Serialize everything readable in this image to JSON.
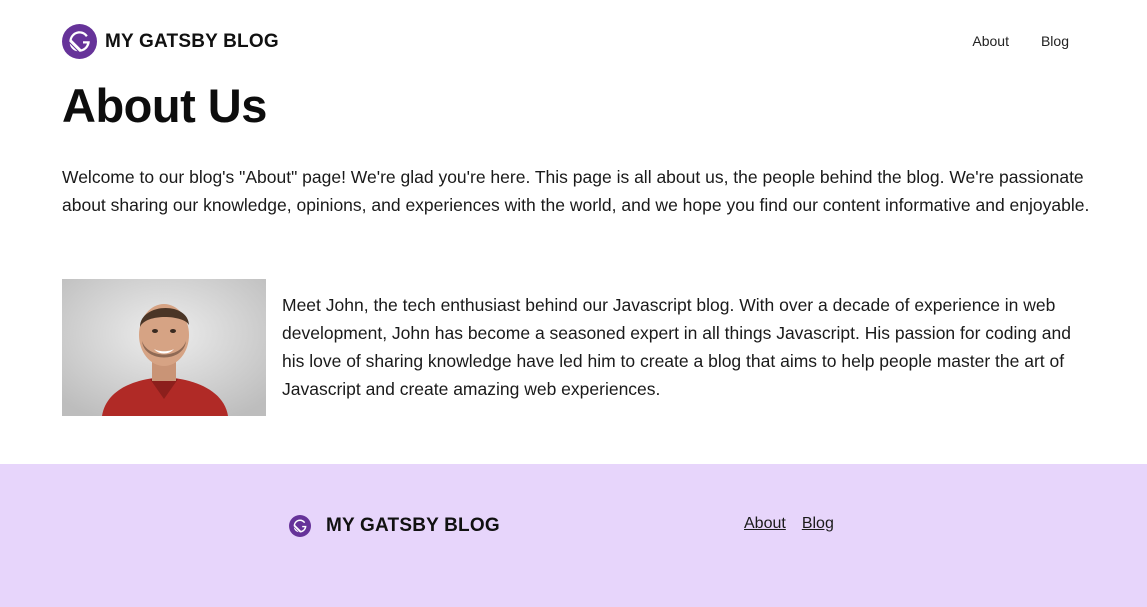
{
  "header": {
    "brand": {
      "logo_icon": "gatsby-logo-icon",
      "title": "MY GATSBY BLOG"
    },
    "nav": [
      {
        "label": "About"
      },
      {
        "label": "Blog"
      }
    ]
  },
  "main": {
    "title": "About Us",
    "intro": "Welcome to our blog's \"About\" page! We're glad you're here. This page is all about us, the people behind the blog. We're passionate about sharing our knowledge, opinions, and experiences with the world, and we hope you find our content informative and enjoyable.",
    "profile": {
      "photo_icon": "author-photo",
      "bio": "Meet John, the tech enthusiast behind our Javascript blog. With over a decade of experience in web development, John has become a seasoned expert in all things Javascript. His passion for coding and his love of sharing knowledge have led him to create a blog that aims to help people master the art of Javascript and create amazing web experiences."
    }
  },
  "footer": {
    "brand": {
      "logo_icon": "gatsby-logo-icon",
      "title": "MY GATSBY BLOG"
    },
    "nav": [
      {
        "label": "About"
      },
      {
        "label": "Blog"
      }
    ]
  },
  "colors": {
    "brand_purple": "#663399",
    "footer_bg": "#e7d5fb",
    "shirt_red": "#b02a26"
  }
}
